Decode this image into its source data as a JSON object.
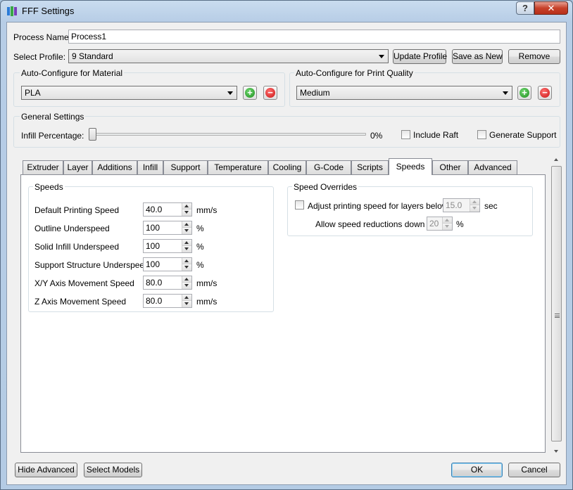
{
  "window": {
    "title": "FFF Settings",
    "help_label": "?",
    "close_label": "✕"
  },
  "process": {
    "label": "Process Name:",
    "value": "Process1"
  },
  "profile": {
    "label": "Select Profile:",
    "selected": "9 Standard",
    "update_label": "Update Profile",
    "save_new_label": "Save as New",
    "remove_label": "Remove"
  },
  "material": {
    "title": "Auto-Configure for Material",
    "selected": "PLA"
  },
  "quality": {
    "title": "Auto-Configure for Print Quality",
    "selected": "Medium"
  },
  "general": {
    "title": "General Settings",
    "infill_label": "Infill Percentage:",
    "infill_value_text": "0%",
    "infill_fraction": 0,
    "raft_label": "Include Raft",
    "support_label": "Generate Support"
  },
  "tabs": [
    "Extruder",
    "Layer",
    "Additions",
    "Infill",
    "Support",
    "Temperature",
    "Cooling",
    "G-Code",
    "Scripts",
    "Speeds",
    "Other",
    "Advanced"
  ],
  "active_tab": "Speeds",
  "speeds": {
    "title": "Speeds",
    "rows": [
      {
        "label": "Default Printing Speed",
        "value": "40.0",
        "unit": "mm/s"
      },
      {
        "label": "Outline Underspeed",
        "value": "100",
        "unit": "%"
      },
      {
        "label": "Solid Infill Underspeed",
        "value": "100",
        "unit": "%"
      },
      {
        "label": "Support Structure Underspeed",
        "value": "100",
        "unit": "%"
      },
      {
        "label": "X/Y Axis Movement Speed",
        "value": "80.0",
        "unit": "mm/s"
      },
      {
        "label": "Z Axis Movement Speed",
        "value": "80.0",
        "unit": "mm/s"
      }
    ]
  },
  "overrides": {
    "title": "Speed Overrides",
    "adjust_label": "Adjust printing speed for layers below",
    "adjust_value": "15.0",
    "adjust_unit": "sec",
    "allow_label": "Allow speed reductions down to",
    "allow_value": "20",
    "allow_unit": "%"
  },
  "footer": {
    "hide_advanced_label": "Hide Advanced",
    "select_models_label": "Select Models",
    "ok_label": "OK",
    "cancel_label": "Cancel"
  }
}
